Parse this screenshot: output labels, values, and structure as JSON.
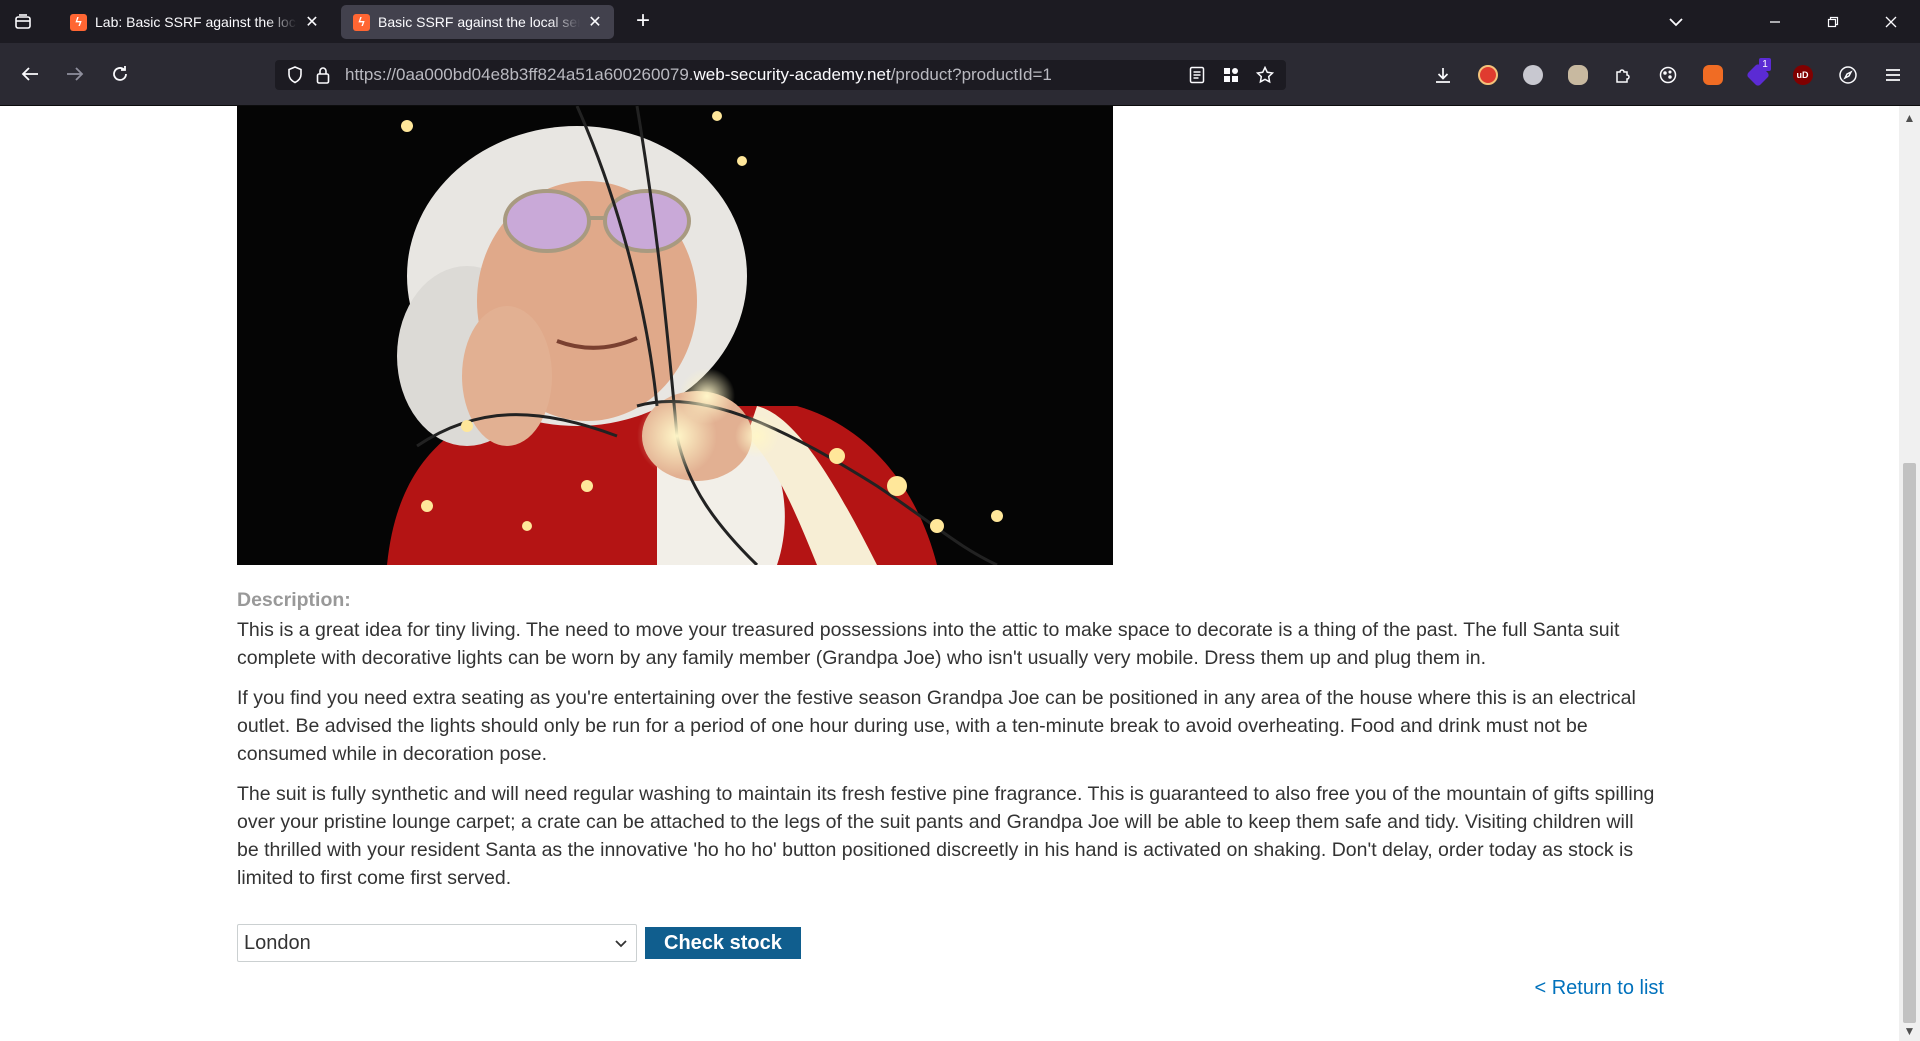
{
  "browser": {
    "tabs": [
      {
        "title": "Lab: Basic SSRF against the local server",
        "favicon": "bolt-icon",
        "active": false
      },
      {
        "title": "Basic SSRF against the local server",
        "favicon": "bolt-icon",
        "active": true
      }
    ],
    "url": {
      "scheme_prefix": "https://0aa000bd04e8b3ff824a51a600260079.",
      "host": "web-security-academy.net",
      "path": "/product?productId=1"
    },
    "extensions": [
      {
        "name": "shield-ext-icon",
        "color": "#e03b2f"
      },
      {
        "name": "glasses-ext-icon",
        "color": "#c8c8d0"
      },
      {
        "name": "mask-ext-icon",
        "color": "#c8b9a0"
      },
      {
        "name": "puzzle-icon",
        "color": "#fbfbfe"
      },
      {
        "name": "cookie-icon",
        "color": "#fbfbfe"
      },
      {
        "name": "fox-ext-icon",
        "color": "#f06c24"
      },
      {
        "name": "hexagon-ext-icon",
        "color": "#5b2bd4",
        "badge": "1"
      },
      {
        "name": "ublock-icon",
        "color": "#800000",
        "text": "uD"
      },
      {
        "name": "compass-icon",
        "color": "#fbfbfe"
      },
      {
        "name": "menu-icon",
        "color": "#fbfbfe"
      }
    ]
  },
  "product": {
    "image_alt": "Santa suit with decorative lights",
    "description_label": "Description:",
    "paragraphs": [
      "This is a great idea for tiny living. The need to move your treasured possessions into the attic to make space to decorate is a thing of the past. The full Santa suit complete with decorative lights can be worn by any family member (Grandpa Joe) who isn't usually very mobile. Dress them up and plug them in.",
      "If you find you need extra seating as you're entertaining over the festive season Grandpa Joe can be positioned in any area of the house where this is an electrical outlet. Be advised the lights should only be run for a period of one hour during use, with a ten-minute break to avoid overheating. Food and drink must not be consumed while in decoration pose.",
      "The suit is fully synthetic and will need regular washing to maintain its fresh festive pine fragrance. This is guaranteed to also free you of the mountain of gifts spilling over your pristine lounge carpet; a crate can be attached to the legs of the suit pants and Grandpa Joe will be able to keep them safe and tidy. Visiting children will be thrilled with your resident Santa as the innovative 'ho ho ho' button positioned discreetly in his hand is activated on shaking. Don't delay, order today as stock is limited to first come first served."
    ],
    "stock_select_value": "London",
    "check_stock_label": "Check stock",
    "return_link": "< Return to list"
  }
}
